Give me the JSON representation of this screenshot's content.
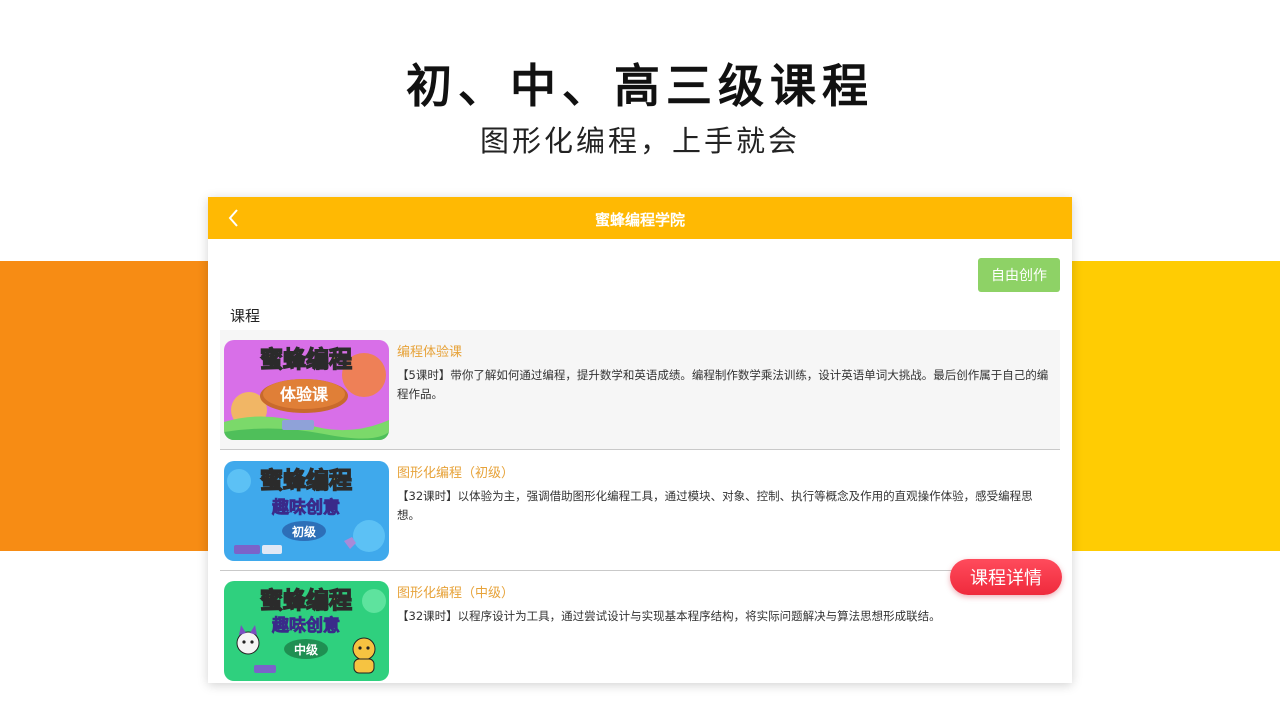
{
  "promo": {
    "headline": "初、中、高三级课程",
    "subline": "图形化编程，上手就会"
  },
  "app": {
    "title": "蜜蜂编程学院",
    "back_icon": "chevron-left-icon",
    "free_create_label": "自由创作",
    "section_title": "课程"
  },
  "courses": [
    {
      "thumb_title": "蜜蜂编程",
      "thumb_badge": "体验课",
      "title": "编程体验课",
      "desc": "【5课时】带你了解如何通过编程，提升数学和英语成绩。编程制作数学乘法训练，设计英语单词大挑战。最后创作属于自己的编程作品。"
    },
    {
      "thumb_title": "蜜蜂编程",
      "thumb_subtitle": "趣味创意",
      "thumb_badge": "初级",
      "title": "图形化编程（初级）",
      "desc": "【32课时】以体验为主，强调借助图形化编程工具，通过模块、对象、控制、执行等概念及作用的直观操作体验，感受编程思想。"
    },
    {
      "thumb_title": "蜜蜂编程",
      "thumb_subtitle": "趣味创意",
      "thumb_badge": "中级",
      "title": "图形化编程（中级）",
      "desc": "【32课时】以程序设计为工具，通过尝试设计与实现基本程序结构，将实际问题解决与算法思想形成联结。"
    }
  ],
  "detail_button_label": "课程详情",
  "colors": {
    "header": "#ffb903",
    "band_left": "#f78c14",
    "band_right": "#ffcc03",
    "free_btn": "#8ed266",
    "course_title": "#e7a33a",
    "detail_btn": "#ef2a3c"
  }
}
